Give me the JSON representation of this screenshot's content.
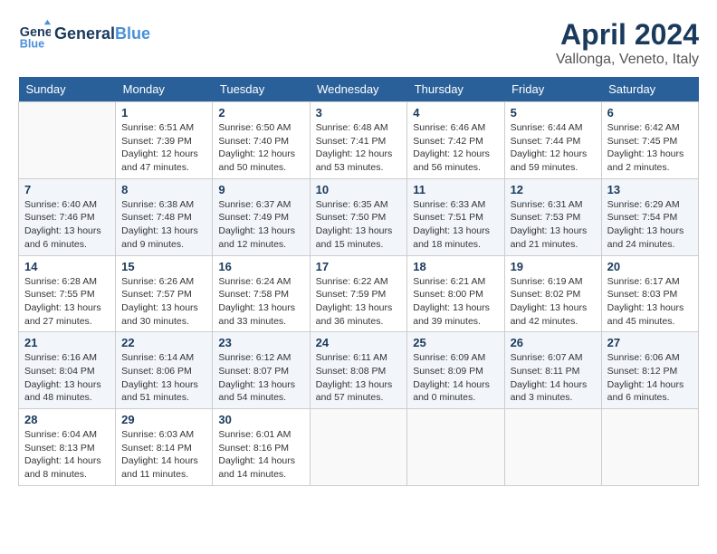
{
  "header": {
    "logo_line1": "General",
    "logo_line2": "Blue",
    "month": "April 2024",
    "location": "Vallonga, Veneto, Italy"
  },
  "weekdays": [
    "Sunday",
    "Monday",
    "Tuesday",
    "Wednesday",
    "Thursday",
    "Friday",
    "Saturday"
  ],
  "weeks": [
    [
      {
        "day": "",
        "sunrise": "",
        "sunset": "",
        "daylight": ""
      },
      {
        "day": "1",
        "sunrise": "Sunrise: 6:51 AM",
        "sunset": "Sunset: 7:39 PM",
        "daylight": "Daylight: 12 hours and 47 minutes."
      },
      {
        "day": "2",
        "sunrise": "Sunrise: 6:50 AM",
        "sunset": "Sunset: 7:40 PM",
        "daylight": "Daylight: 12 hours and 50 minutes."
      },
      {
        "day": "3",
        "sunrise": "Sunrise: 6:48 AM",
        "sunset": "Sunset: 7:41 PM",
        "daylight": "Daylight: 12 hours and 53 minutes."
      },
      {
        "day": "4",
        "sunrise": "Sunrise: 6:46 AM",
        "sunset": "Sunset: 7:42 PM",
        "daylight": "Daylight: 12 hours and 56 minutes."
      },
      {
        "day": "5",
        "sunrise": "Sunrise: 6:44 AM",
        "sunset": "Sunset: 7:44 PM",
        "daylight": "Daylight: 12 hours and 59 minutes."
      },
      {
        "day": "6",
        "sunrise": "Sunrise: 6:42 AM",
        "sunset": "Sunset: 7:45 PM",
        "daylight": "Daylight: 13 hours and 2 minutes."
      }
    ],
    [
      {
        "day": "7",
        "sunrise": "Sunrise: 6:40 AM",
        "sunset": "Sunset: 7:46 PM",
        "daylight": "Daylight: 13 hours and 6 minutes."
      },
      {
        "day": "8",
        "sunrise": "Sunrise: 6:38 AM",
        "sunset": "Sunset: 7:48 PM",
        "daylight": "Daylight: 13 hours and 9 minutes."
      },
      {
        "day": "9",
        "sunrise": "Sunrise: 6:37 AM",
        "sunset": "Sunset: 7:49 PM",
        "daylight": "Daylight: 13 hours and 12 minutes."
      },
      {
        "day": "10",
        "sunrise": "Sunrise: 6:35 AM",
        "sunset": "Sunset: 7:50 PM",
        "daylight": "Daylight: 13 hours and 15 minutes."
      },
      {
        "day": "11",
        "sunrise": "Sunrise: 6:33 AM",
        "sunset": "Sunset: 7:51 PM",
        "daylight": "Daylight: 13 hours and 18 minutes."
      },
      {
        "day": "12",
        "sunrise": "Sunrise: 6:31 AM",
        "sunset": "Sunset: 7:53 PM",
        "daylight": "Daylight: 13 hours and 21 minutes."
      },
      {
        "day": "13",
        "sunrise": "Sunrise: 6:29 AM",
        "sunset": "Sunset: 7:54 PM",
        "daylight": "Daylight: 13 hours and 24 minutes."
      }
    ],
    [
      {
        "day": "14",
        "sunrise": "Sunrise: 6:28 AM",
        "sunset": "Sunset: 7:55 PM",
        "daylight": "Daylight: 13 hours and 27 minutes."
      },
      {
        "day": "15",
        "sunrise": "Sunrise: 6:26 AM",
        "sunset": "Sunset: 7:57 PM",
        "daylight": "Daylight: 13 hours and 30 minutes."
      },
      {
        "day": "16",
        "sunrise": "Sunrise: 6:24 AM",
        "sunset": "Sunset: 7:58 PM",
        "daylight": "Daylight: 13 hours and 33 minutes."
      },
      {
        "day": "17",
        "sunrise": "Sunrise: 6:22 AM",
        "sunset": "Sunset: 7:59 PM",
        "daylight": "Daylight: 13 hours and 36 minutes."
      },
      {
        "day": "18",
        "sunrise": "Sunrise: 6:21 AM",
        "sunset": "Sunset: 8:00 PM",
        "daylight": "Daylight: 13 hours and 39 minutes."
      },
      {
        "day": "19",
        "sunrise": "Sunrise: 6:19 AM",
        "sunset": "Sunset: 8:02 PM",
        "daylight": "Daylight: 13 hours and 42 minutes."
      },
      {
        "day": "20",
        "sunrise": "Sunrise: 6:17 AM",
        "sunset": "Sunset: 8:03 PM",
        "daylight": "Daylight: 13 hours and 45 minutes."
      }
    ],
    [
      {
        "day": "21",
        "sunrise": "Sunrise: 6:16 AM",
        "sunset": "Sunset: 8:04 PM",
        "daylight": "Daylight: 13 hours and 48 minutes."
      },
      {
        "day": "22",
        "sunrise": "Sunrise: 6:14 AM",
        "sunset": "Sunset: 8:06 PM",
        "daylight": "Daylight: 13 hours and 51 minutes."
      },
      {
        "day": "23",
        "sunrise": "Sunrise: 6:12 AM",
        "sunset": "Sunset: 8:07 PM",
        "daylight": "Daylight: 13 hours and 54 minutes."
      },
      {
        "day": "24",
        "sunrise": "Sunrise: 6:11 AM",
        "sunset": "Sunset: 8:08 PM",
        "daylight": "Daylight: 13 hours and 57 minutes."
      },
      {
        "day": "25",
        "sunrise": "Sunrise: 6:09 AM",
        "sunset": "Sunset: 8:09 PM",
        "daylight": "Daylight: 14 hours and 0 minutes."
      },
      {
        "day": "26",
        "sunrise": "Sunrise: 6:07 AM",
        "sunset": "Sunset: 8:11 PM",
        "daylight": "Daylight: 14 hours and 3 minutes."
      },
      {
        "day": "27",
        "sunrise": "Sunrise: 6:06 AM",
        "sunset": "Sunset: 8:12 PM",
        "daylight": "Daylight: 14 hours and 6 minutes."
      }
    ],
    [
      {
        "day": "28",
        "sunrise": "Sunrise: 6:04 AM",
        "sunset": "Sunset: 8:13 PM",
        "daylight": "Daylight: 14 hours and 8 minutes."
      },
      {
        "day": "29",
        "sunrise": "Sunrise: 6:03 AM",
        "sunset": "Sunset: 8:14 PM",
        "daylight": "Daylight: 14 hours and 11 minutes."
      },
      {
        "day": "30",
        "sunrise": "Sunrise: 6:01 AM",
        "sunset": "Sunset: 8:16 PM",
        "daylight": "Daylight: 14 hours and 14 minutes."
      },
      {
        "day": "",
        "sunrise": "",
        "sunset": "",
        "daylight": ""
      },
      {
        "day": "",
        "sunrise": "",
        "sunset": "",
        "daylight": ""
      },
      {
        "day": "",
        "sunrise": "",
        "sunset": "",
        "daylight": ""
      },
      {
        "day": "",
        "sunrise": "",
        "sunset": "",
        "daylight": ""
      }
    ]
  ]
}
